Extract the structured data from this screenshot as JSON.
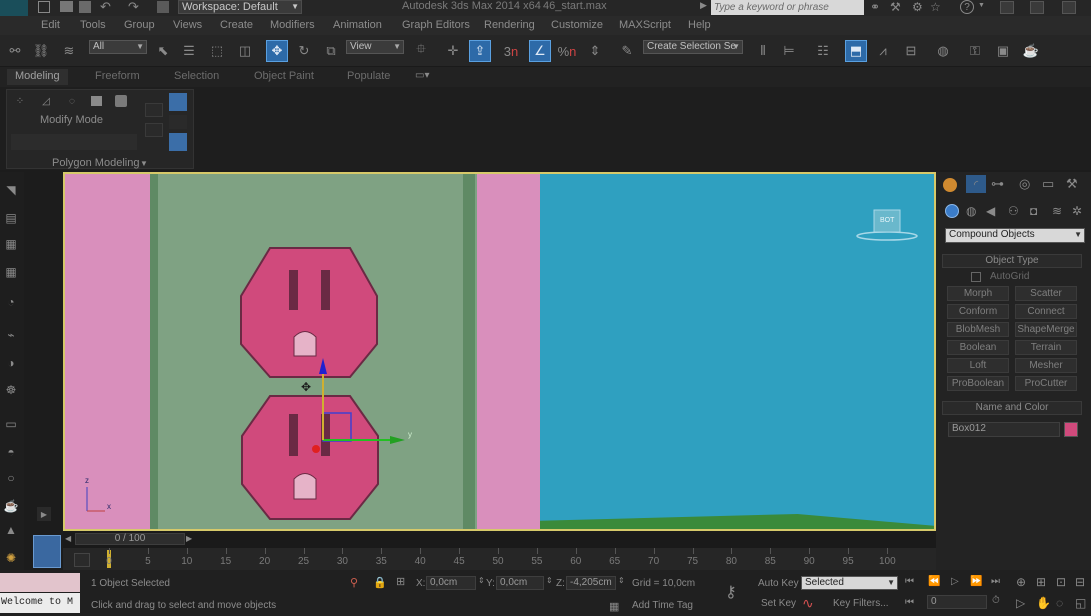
{
  "title_bar": {
    "app_title": "Autodesk 3ds Max  2014 x64",
    "file_name": "46_start.max",
    "workspace_label": "Workspace: Default",
    "search_placeholder": "Type a keyword or phrase"
  },
  "menu": [
    "Edit",
    "Tools",
    "Group",
    "Views",
    "Create",
    "Modifiers",
    "Animation",
    "Graph Editors",
    "Rendering",
    "Customize",
    "MAXScript",
    "Help"
  ],
  "toolbar": {
    "selection_filter": "All",
    "ref_coord": "View",
    "snap_number": "3",
    "angle_snap": "%",
    "named_selection_placeholder": "Create Selection Se"
  },
  "ribbon_tabs": [
    "Modeling",
    "Freeform",
    "Selection",
    "Object Paint",
    "Populate"
  ],
  "ribbon": {
    "mode_label": "Modify Mode",
    "panel_label": "Polygon Modeling"
  },
  "viewport": {
    "axis_y": "y",
    "axis_z": "z",
    "axis_x": "x",
    "viewcube_label": "BOT"
  },
  "command_panel": {
    "category": "Compound Objects",
    "object_type_title": "Object Type",
    "autogrid_label": "AutoGrid",
    "buttons": [
      "Morph",
      "Scatter",
      "Conform",
      "Connect",
      "BlobMesh",
      "ShapeMerge",
      "Boolean",
      "Terrain",
      "Loft",
      "Mesher",
      "ProBoolean",
      "ProCutter"
    ],
    "name_color_title": "Name and Color",
    "object_name": "Box012",
    "object_color": "#d04a7c"
  },
  "timeline": {
    "frame_counter": "0 / 100",
    "ticks": [
      "0",
      "5",
      "10",
      "15",
      "20",
      "25",
      "30",
      "35",
      "40",
      "45",
      "50",
      "55",
      "60",
      "65",
      "70",
      "75",
      "80",
      "85",
      "90",
      "95",
      "100"
    ]
  },
  "status": {
    "maxscript_listener": "Welcome to M",
    "selection_info": "1 Object Selected",
    "prompt": "Click and drag to select and move objects",
    "x_label": "X:",
    "x_value": "0,0cm",
    "y_label": "Y:",
    "y_value": "0,0cm",
    "z_label": "Z:",
    "z_value": "-4,205cm",
    "grid": "Grid = 10,0cm",
    "add_time_tag": "Add Time Tag",
    "auto_key": "Auto Key",
    "set_key": "Set Key",
    "key_mode": "Selected",
    "key_filters": "Key Filters...",
    "current_frame": "0"
  }
}
